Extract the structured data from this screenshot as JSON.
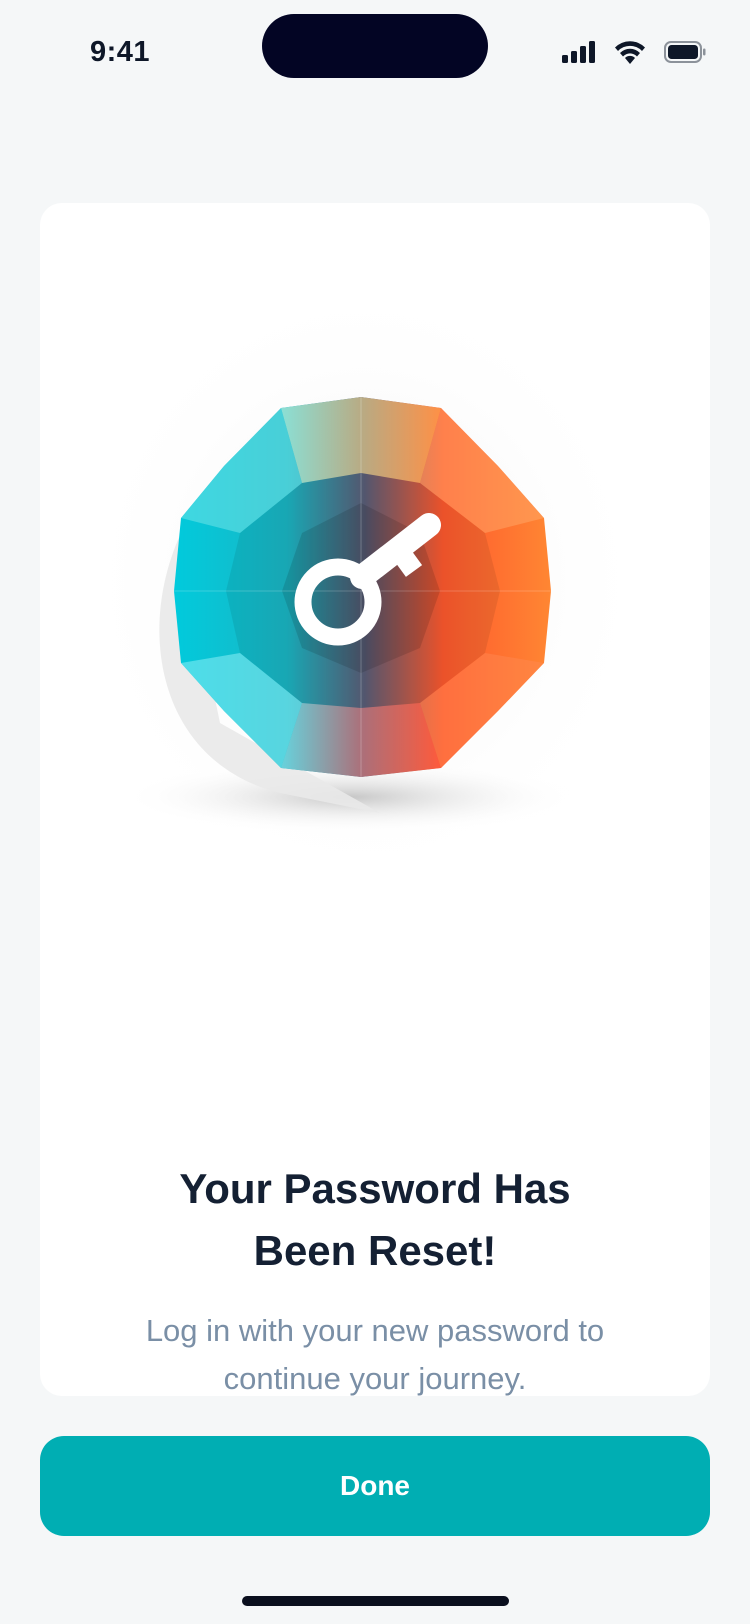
{
  "status_bar": {
    "time": "9:41"
  },
  "illustration": {
    "icon": "key-icon",
    "colors": {
      "teal": "#00C9D8",
      "orange": "#FF7A2F",
      "red": "#FF4E3A"
    }
  },
  "content": {
    "title_line1": "Your Password Has",
    "title_line2": "Been Reset!",
    "subtitle_line1": "Log in with your new password to",
    "subtitle_line2": "continue your journey."
  },
  "actions": {
    "done_label": "Done"
  },
  "colors": {
    "accent": "#00AEB3",
    "title": "#142033",
    "subtitle": "#7A8FA6",
    "background": "#F5F7F8"
  }
}
